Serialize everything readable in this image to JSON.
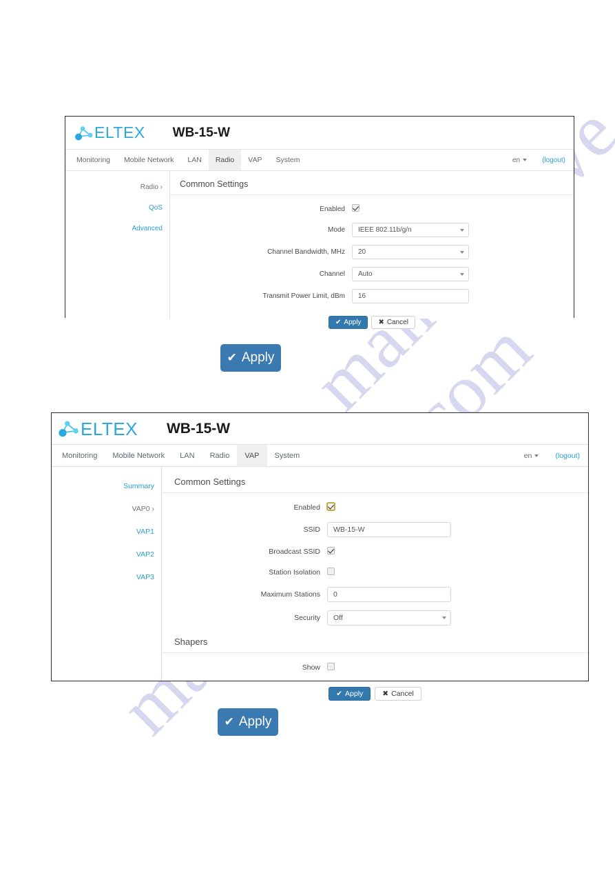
{
  "watermark": {
    "line1": "manualshive.com",
    "line2": "manualshive.com"
  },
  "panel1": {
    "brand": "ELTEX",
    "brand_icon": "molecule-logo-icon",
    "device_title": "WB-15-W",
    "nav_tabs": [
      {
        "label": "Monitoring",
        "active": false
      },
      {
        "label": "Mobile Network",
        "active": false
      },
      {
        "label": "LAN",
        "active": false
      },
      {
        "label": "Radio",
        "active": true
      },
      {
        "label": "VAP",
        "active": false
      },
      {
        "label": "System",
        "active": false
      }
    ],
    "language": "en",
    "logout": "(logout)",
    "side_nav": [
      {
        "label": "Radio ›",
        "current": true
      },
      {
        "label": "QoS",
        "current": false
      },
      {
        "label": "Advanced",
        "current": false
      }
    ],
    "section_title": "Common Settings",
    "fields": [
      {
        "label": "Enabled",
        "type": "checkbox",
        "checked": true,
        "focus": false
      },
      {
        "label": "Mode",
        "type": "select",
        "value": "IEEE 802.11b/g/n"
      },
      {
        "label": "Channel Bandwidth, MHz",
        "type": "select",
        "value": "20"
      },
      {
        "label": "Channel",
        "type": "select",
        "value": "Auto"
      },
      {
        "label": "Transmit Power Limit, dBm",
        "type": "input",
        "value": "16"
      }
    ],
    "apply_label": "Apply",
    "cancel_label": "Cancel"
  },
  "standalone_apply_1": {
    "label": "Apply",
    "icon": "check-icon"
  },
  "panel2": {
    "brand": "ELTEX",
    "brand_icon": "molecule-logo-icon",
    "device_title": "WB-15-W",
    "nav_tabs": [
      {
        "label": "Monitoring",
        "active": false
      },
      {
        "label": "Mobile Network",
        "active": false
      },
      {
        "label": "LAN",
        "active": false
      },
      {
        "label": "Radio",
        "active": false
      },
      {
        "label": "VAP",
        "active": true
      },
      {
        "label": "System",
        "active": false
      }
    ],
    "language": "en",
    "logout": "(logout)",
    "side_nav": [
      {
        "label": "Summary",
        "current": false
      },
      {
        "label": "VAP0 ›",
        "current": true
      },
      {
        "label": "VAP1",
        "current": false
      },
      {
        "label": "VAP2",
        "current": false
      },
      {
        "label": "VAP3",
        "current": false
      }
    ],
    "section_title": "Common Settings",
    "fields": [
      {
        "label": "Enabled",
        "type": "checkbox",
        "checked": true,
        "focus": true
      },
      {
        "label": "SSID",
        "type": "input",
        "value": "WB-15-W"
      },
      {
        "label": "Broadcast SSID",
        "type": "checkbox",
        "checked": true,
        "focus": false
      },
      {
        "label": "Station Isolation",
        "type": "checkbox",
        "checked": false,
        "focus": false
      },
      {
        "label": "Maximum Stations",
        "type": "input",
        "value": "0"
      },
      {
        "label": "Security",
        "type": "select",
        "value": "Off"
      }
    ],
    "shapers_title": "Shapers",
    "shapers_fields": [
      {
        "label": "Show",
        "type": "checkbox",
        "checked": false,
        "focus": false
      }
    ],
    "apply_label": "Apply",
    "cancel_label": "Cancel"
  },
  "standalone_apply_2": {
    "label": "Apply",
    "icon": "check-icon"
  },
  "colors": {
    "brand_blue": "#2ca8e0",
    "link_blue": "#2a9fd6",
    "button_blue": "#3479ad",
    "big_button_blue": "#3b7ab0",
    "tab_active_bg": "#efefef",
    "watermark": "#c9c9ea"
  }
}
